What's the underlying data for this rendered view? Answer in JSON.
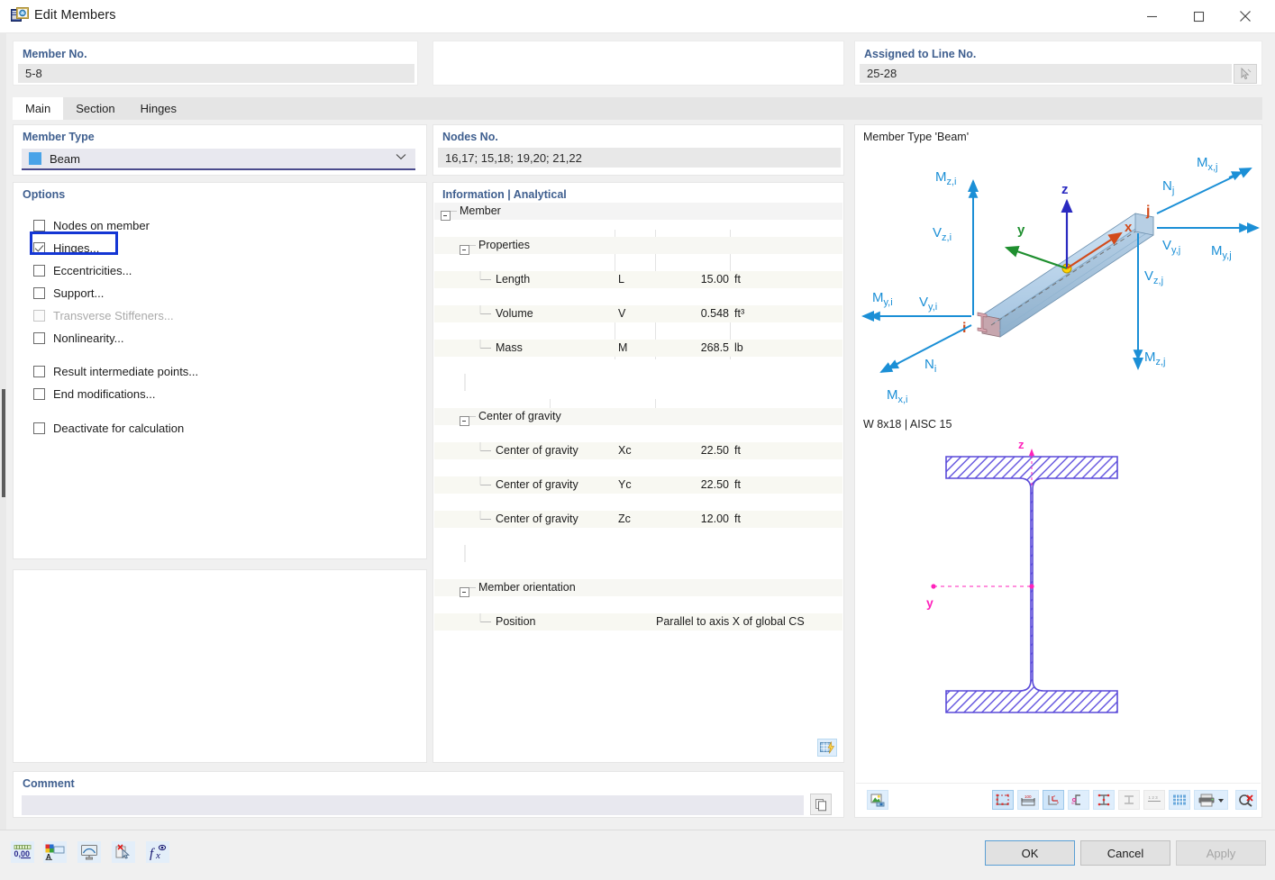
{
  "window": {
    "title": "Edit Members",
    "icon": "edit-members-icon",
    "minimize": "—",
    "maximize": "☐",
    "close": "✕"
  },
  "header": {
    "member_no_label": "Member No.",
    "member_no_value": "5-8",
    "assigned_line_label": "Assigned to Line No.",
    "assigned_line_value": "25-28",
    "pick_icon": "pick-cursor-icon"
  },
  "tabs": [
    {
      "label": "Main",
      "active": true
    },
    {
      "label": "Section",
      "active": false
    },
    {
      "label": "Hinges",
      "active": false
    }
  ],
  "member_type": {
    "group_label": "Member Type",
    "selected": "Beam",
    "swatch_color": "#4aa3e8",
    "arrow": "˅"
  },
  "options": {
    "group_label": "Options",
    "items": [
      {
        "label": "Nodes on member",
        "checked": false,
        "disabled": false,
        "highlighted": false
      },
      {
        "label": "Hinges...",
        "checked": true,
        "disabled": false,
        "highlighted": true
      },
      {
        "label": "Eccentricities...",
        "checked": false,
        "disabled": false,
        "highlighted": false
      },
      {
        "label": "Support...",
        "checked": false,
        "disabled": false,
        "highlighted": false
      },
      {
        "label": "Transverse Stiffeners...",
        "checked": false,
        "disabled": true,
        "highlighted": false
      },
      {
        "label": "Nonlinearity...",
        "checked": false,
        "disabled": false,
        "highlighted": false
      },
      {
        "label": "Result intermediate points...",
        "checked": false,
        "disabled": false,
        "highlighted": false
      },
      {
        "label": "End modifications...",
        "checked": false,
        "disabled": false,
        "highlighted": false
      },
      {
        "label": "Deactivate for calculation",
        "checked": false,
        "disabled": false,
        "highlighted": false
      }
    ]
  },
  "nodes": {
    "group_label": "Nodes No.",
    "value": "16,17; 15,18; 19,20; 21,22"
  },
  "information": {
    "group_label": "Information | Analytical",
    "root": "Member",
    "groups": [
      {
        "name": "Properties",
        "rows": [
          {
            "label": "Length",
            "symbol": "L",
            "value": "15.00",
            "unit": "ft"
          },
          {
            "label": "Volume",
            "symbol": "V",
            "value": "0.548",
            "unit": "ft³"
          },
          {
            "label": "Mass",
            "symbol": "M",
            "value": "268.5",
            "unit": "lb"
          }
        ]
      },
      {
        "name": "Center of gravity",
        "rows": [
          {
            "label": "Center of gravity",
            "symbol": "Xc",
            "value": "22.50",
            "unit": "ft"
          },
          {
            "label": "Center of gravity",
            "symbol": "Yc",
            "value": "22.50",
            "unit": "ft"
          },
          {
            "label": "Center of gravity",
            "symbol": "Zc",
            "value": "12.00",
            "unit": "ft"
          }
        ]
      },
      {
        "name": "Member orientation",
        "rows": [
          {
            "label": "Position",
            "symbol": "",
            "value": "Parallel to axis X of global CS",
            "unit": "",
            "wide": true
          }
        ]
      }
    ],
    "footer_icon": "table-lightning-icon"
  },
  "graphics": {
    "member_caption": "Member Type 'Beam'",
    "section_caption": "W 8x18 | AISC 15",
    "axes": {
      "x": "x",
      "y": "y",
      "z": "z"
    },
    "end_nodes": {
      "i": "i",
      "j": "j"
    },
    "force_labels": [
      "M_z,i",
      "V_z,i",
      "M_y,i",
      "V_y,i",
      "N_i",
      "M_x,i",
      "M_x,j",
      "N_j",
      "V_y,j",
      "M_y,j",
      "V_z,j",
      "M_z,j"
    ],
    "section_axes": {
      "y": "y",
      "z": "z"
    },
    "render_button_icon": "render-photo-icon",
    "toolbar_icons": [
      "section-outline-icon",
      "dimensions-icon",
      "local-axes-icon",
      "shear-center-icon",
      "stress-points-icon",
      "parts-icon",
      "numbering-icon",
      "grid-icon",
      "print-icon",
      "print-dropdown-icon",
      "zoom-reset-icon"
    ]
  },
  "comment": {
    "group_label": "Comment",
    "value": "",
    "arrow": "˅",
    "copy_icon": "copy-icon"
  },
  "footer": {
    "tool_icons": [
      "decimal-places-icon",
      "colors-icon",
      "display-props-icon",
      "deselect-icon",
      "formula-icon"
    ],
    "ok": "OK",
    "cancel": "Cancel",
    "apply": "Apply"
  }
}
